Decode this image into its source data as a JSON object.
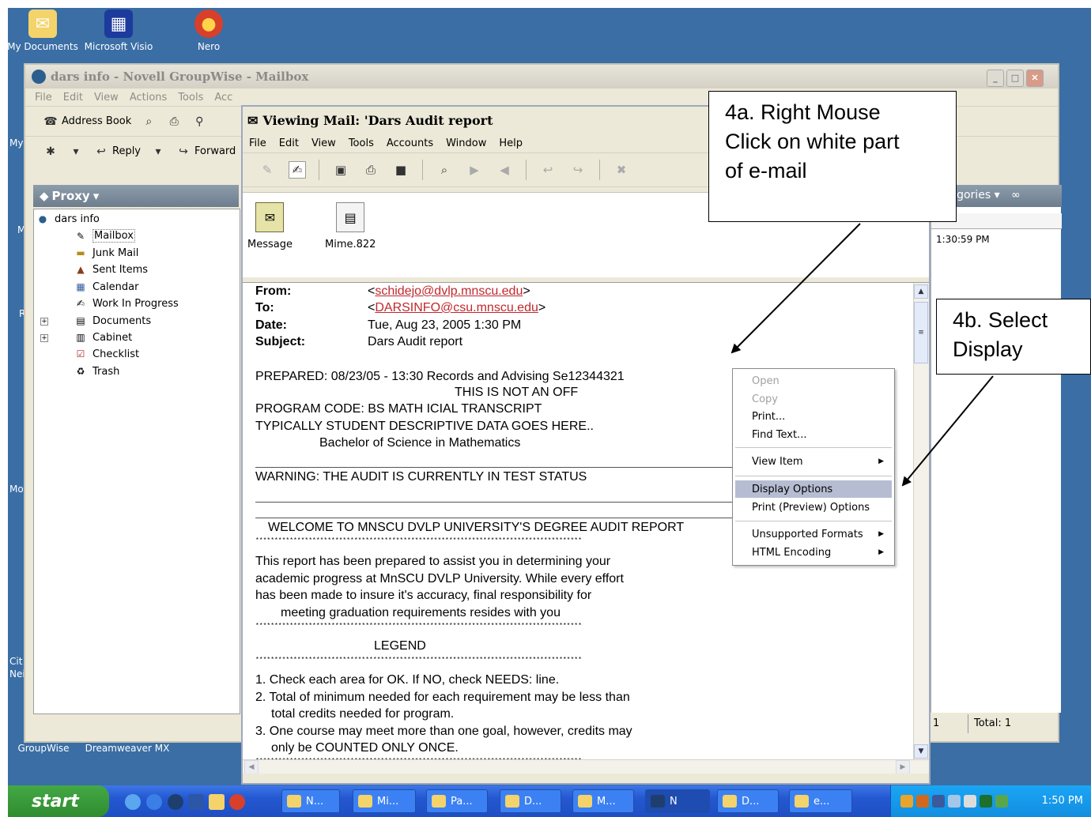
{
  "desktop": {
    "icons": [
      {
        "label": "My Documents"
      },
      {
        "label": "Microsoft Visio"
      },
      {
        "label": "Nero"
      }
    ],
    "bottom_icons": [
      {
        "label": "GroupWise"
      },
      {
        "label": "Dreamweaver MX"
      }
    ],
    "clipped_labels": [
      "My",
      "M",
      "R",
      "Mo",
      "Cit",
      "Nei"
    ]
  },
  "groupwise": {
    "title": "dars info - Novell GroupWise - Mailbox",
    "menu": [
      "File",
      "Edit",
      "View",
      "Actions",
      "Tools",
      "Acc"
    ],
    "toolbar1": {
      "address_book": "Address Book"
    },
    "toolbar2": {
      "reply": "Reply",
      "forward": "Forward"
    },
    "proxy_label": "Proxy",
    "folders": {
      "root": "dars info",
      "items": [
        {
          "label": "Mailbox"
        },
        {
          "label": "Junk Mail"
        },
        {
          "label": "Sent Items"
        },
        {
          "label": "Calendar"
        },
        {
          "label": "Work In Progress"
        },
        {
          "label": "Documents"
        },
        {
          "label": "Cabinet"
        },
        {
          "label": "Checklist"
        },
        {
          "label": "Trash"
        }
      ]
    },
    "categories_label": "tegories",
    "list_time": "1:30:59 PM",
    "status_left": "1",
    "status_total": "Total: 1"
  },
  "viewer": {
    "title": "Viewing Mail: 'Dars Audit report",
    "menu": [
      "File",
      "Edit",
      "View",
      "Tools",
      "Accounts",
      "Window",
      "Help"
    ],
    "attachments": [
      {
        "label": "Message"
      },
      {
        "label": "Mime.822"
      }
    ],
    "headers": {
      "from_label": "From:",
      "from_value": "schidejo@dvlp.mnscu.edu",
      "to_label": "To:",
      "to_value": "DARSINFO@csu.mnscu.edu",
      "date_label": "Date:",
      "date_value": "Tue, Aug 23, 2005  1:30 PM",
      "subject_label": "Subject:",
      "subject_value": "Dars Audit report"
    },
    "body": {
      "prepared": "PREPARED: 08/23/05 - 13:30   Records and Advising Se12344321",
      "not_official": "THIS IS NOT AN OFF",
      "program": "PROGRAM CODE: BS  MATH      ICIAL TRANSCRIPT",
      "typically": "TYPICALLY STUDENT DESCRIPTIVE DATA GOES HERE..",
      "degree": "Bachelor of Science in Mathematics",
      "warning": "WARNING: THE AUDIT IS CURRENTLY IN TEST STATUS",
      "welcome": "WELCOME TO MNSCU DVLP UNIVERSITY'S DEGREE AUDIT REPORT",
      "stars": "**************************************************************************************",
      "para": [
        "This report has been prepared to assist you in determining your",
        "academic progress at MnSCU DVLP University.  While every effort",
        "has been made to insure it's accuracy, final responsibility for",
        "meeting graduation requirements resides with you"
      ],
      "legend": "LEGEND",
      "legend_items": [
        "1.  Check each area for OK.  If NO, check NEEDS:  line.",
        "2.  Total of minimum needed for each requirement may be less than",
        "total credits needed for program.",
        "3.  One course may meet more than one goal, however, credits may",
        "only be COUNTED ONLY ONCE."
      ]
    }
  },
  "context_menu": {
    "items": [
      {
        "label": "Open",
        "enabled": false
      },
      {
        "label": "Copy",
        "enabled": false
      },
      {
        "label": "Print...",
        "enabled": true
      },
      {
        "label": "Find Text...",
        "enabled": true
      },
      {
        "label": "View Item",
        "enabled": true,
        "submenu": true
      },
      {
        "label": "Display Options",
        "enabled": true,
        "highlighted": true
      },
      {
        "label": "Print (Preview) Options",
        "enabled": true
      },
      {
        "label": "Unsupported Formats",
        "enabled": true,
        "submenu": true
      },
      {
        "label": "HTML Encoding",
        "enabled": true,
        "submenu": true
      }
    ]
  },
  "callouts": {
    "a_lines": [
      "4a.   Right Mouse",
      "Click on white part",
      "of e-mail"
    ],
    "b_lines": [
      "4b.   Select",
      "Display"
    ]
  },
  "taskbar": {
    "start": "start",
    "tasks": [
      "N...",
      "Mi...",
      "Pa...",
      "D...",
      "M...",
      "N",
      "D...",
      "e..."
    ],
    "clock": "1:50 PM"
  },
  "colors": {
    "desktop": "#3a6ea5",
    "highlight": "#b6bdd2",
    "link": "#c0282d",
    "taskbar": "#2458d1"
  }
}
